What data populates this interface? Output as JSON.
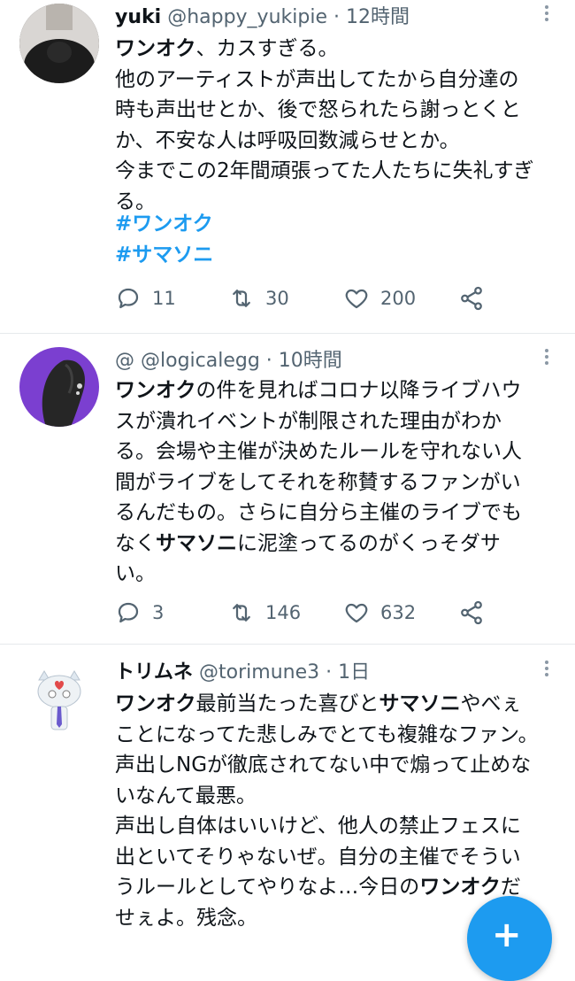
{
  "tweets": [
    {
      "name": "yuki",
      "handle": "@happy_yukipie",
      "dot": "·",
      "time": "12時間",
      "lines": [
        [
          {
            "t": "ワンオク",
            "b": true
          },
          {
            "t": "、カスすぎる。"
          }
        ],
        [
          {
            "t": "他のアーティストが声出してたから自分達の"
          }
        ],
        [
          {
            "t": "時も声出せとか、後で怒られたら謝っとくと"
          }
        ],
        [
          {
            "t": "か、不安な人は呼吸回数減らせとか。"
          }
        ],
        [
          {
            "t": "今までこの2年間頑張ってた人たちに失礼すぎ"
          }
        ],
        [
          {
            "t": "る。"
          }
        ]
      ],
      "hashtags": [
        "#ワンオク",
        "#サマソニ"
      ],
      "replies": "11",
      "retweets": "30",
      "likes": "200"
    },
    {
      "name": "",
      "handle": "@ @logicalegg",
      "dot": "·",
      "time": "10時間",
      "lines": [
        [
          {
            "t": "ワンオク",
            "b": true
          },
          {
            "t": "の件を見ればコロナ以降ライブハウ"
          }
        ],
        [
          {
            "t": "スが潰れイベントが制限された理由がわか"
          }
        ],
        [
          {
            "t": "る。会場や主催が決めたルールを守れない人"
          }
        ],
        [
          {
            "t": "間がライブをしてそれを称賛するファンがい"
          }
        ],
        [
          {
            "t": "るんだもの。さらに自分ら主催のライブでも"
          }
        ],
        [
          {
            "t": "なく"
          },
          {
            "t": "サマソニ",
            "b": true
          },
          {
            "t": "に泥塗ってるのがくっそダサ"
          }
        ],
        [
          {
            "t": "い。"
          }
        ]
      ],
      "hashtags": [],
      "replies": "3",
      "retweets": "146",
      "likes": "632"
    },
    {
      "name": "トリムネ",
      "handle": "@torimune3",
      "dot": "·",
      "time": "1日",
      "lines": [
        [
          {
            "t": "ワンオク",
            "b": true
          },
          {
            "t": "最前当たった喜びと"
          },
          {
            "t": "サマソニ",
            "b": true
          },
          {
            "t": "やべぇ"
          }
        ],
        [
          {
            "t": "ことになってた悲しみでとても複雑なファン。"
          }
        ],
        [
          {
            "t": "声出しNGが徹底されてない中で煽って止めな"
          }
        ],
        [
          {
            "t": "いなんて最悪。"
          }
        ],
        [
          {
            "t": "声出し自体はいいけど、他人の禁止フェスに"
          }
        ],
        [
          {
            "t": "出といてそりゃないぜ。自分の主催でそうい"
          }
        ],
        [
          {
            "t": "うルールとしてやりなよ…今日の"
          },
          {
            "t": "ワンオク",
            "b": true
          },
          {
            "t": "だ"
          }
        ],
        [
          {
            "t": "せぇよ。残念。"
          }
        ]
      ],
      "hashtags": []
    }
  ],
  "fab": {
    "label": "+"
  },
  "colors": {
    "accent": "#1d9bf0",
    "muted": "#536471",
    "text": "#0f1419"
  }
}
